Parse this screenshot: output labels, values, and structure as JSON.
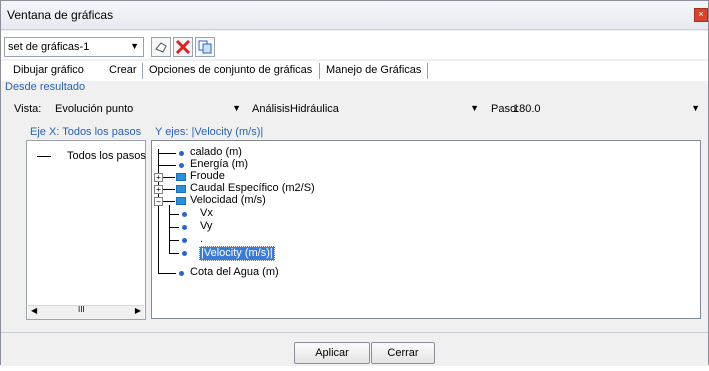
{
  "window": {
    "title": "Ventana de gráficas",
    "close": "×"
  },
  "toolbar": {
    "set_select_value": "set de gráficas-1",
    "icons": [
      "new-set-icon",
      "delete-icon",
      "copy-icon"
    ]
  },
  "tabs": [
    {
      "label": "Dibujar gráfico"
    },
    {
      "label": "Crear"
    },
    {
      "label": "Opciones de conjunto de gráficas"
    },
    {
      "label": "Manejo de Gráficas"
    }
  ],
  "group": {
    "title": "Desde resultado"
  },
  "fields": {
    "vista_label": "Vista:",
    "vista_value": "Evolución punto",
    "analisis_label": "Análisis:",
    "analisis_value": "Hidráulica",
    "paso_label": "Paso:",
    "paso_value": "180.0"
  },
  "x_axis": {
    "header": "Eje X: Todos los pasos",
    "items": [
      "Todos los pasos"
    ]
  },
  "y_axis": {
    "header": "Y ejes: |Velocity (m/s)|",
    "items": [
      "calado (m)",
      "Energía (m)",
      "Froude",
      "Caudal Específico (m2/S)",
      "Velocidad (m/s)",
      "Vx",
      "Vy",
      ".",
      "|Velocity (m/s)|",
      "Cota del Agua (m)"
    ]
  },
  "scroll": {
    "glyph": "III"
  },
  "buttons": {
    "apply": "Aplicar",
    "close": "Cerrar"
  },
  "colors": {
    "accent": "#2a62b4",
    "selection": "#3a7bd5"
  }
}
